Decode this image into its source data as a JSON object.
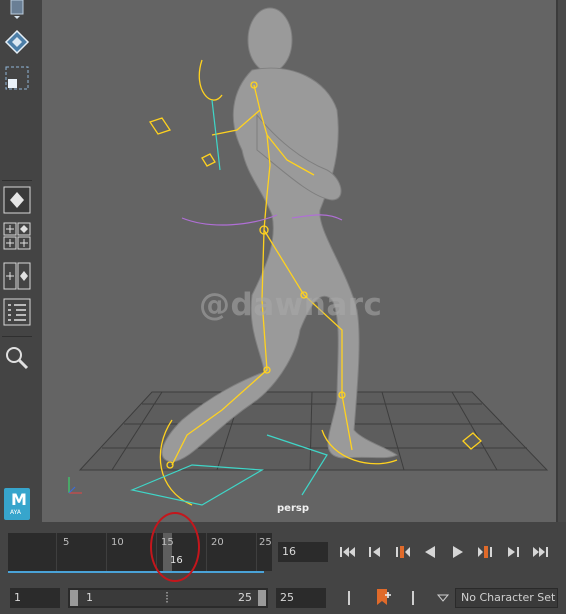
{
  "toolbox": {
    "tools": [
      "rotate-tool",
      "move-tool",
      "scale-tool",
      "single-perspective-layout",
      "four-view-layout",
      "two-view-layout",
      "outliner-layout",
      "search-tool"
    ]
  },
  "viewport": {
    "camera_label": "persp",
    "watermark": "@dawnarc",
    "colors": {
      "background": "#646464",
      "rig": "#ffd21f",
      "grid": "#3a3a3a",
      "accent_cyan": "#3fd6c8"
    }
  },
  "maya_logo": {
    "letter": "M",
    "sub": "AYA"
  },
  "timeline": {
    "ticks": [
      "5",
      "10",
      "15",
      "20",
      "25"
    ],
    "current_frame_marker": "16",
    "range_color": "#4aa3d8"
  },
  "playback": {
    "current_frame": "16",
    "buttons": [
      "go-to-start",
      "step-back-frame",
      "step-back-key",
      "play-backwards",
      "play-forwards",
      "step-forward-key",
      "step-forward-frame",
      "go-to-end"
    ]
  },
  "range_slider": {
    "start_field": "1",
    "inner_start": "1",
    "inner_end": "25",
    "end_field": "25"
  },
  "character_set": {
    "label": "No Character Set"
  }
}
